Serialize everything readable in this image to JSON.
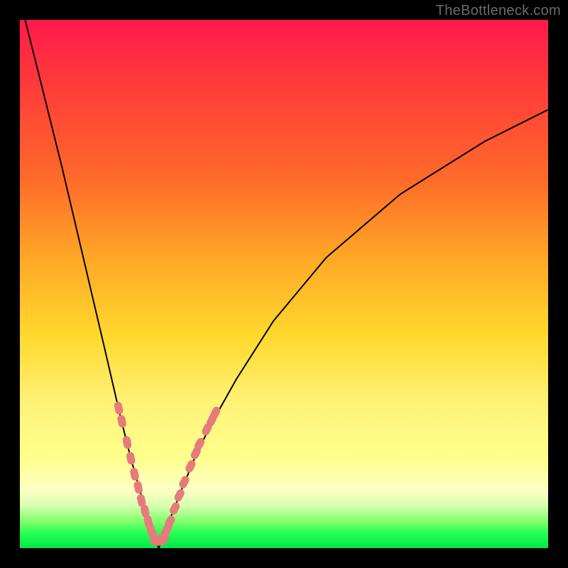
{
  "watermark": "TheBottleneck.com",
  "colors": {
    "background_frame": "#000000",
    "gradient_top": "#ff1a4d",
    "gradient_bottom": "#00e846",
    "curve": "#000000",
    "bead": "#e77a7a"
  },
  "chart_data": {
    "type": "line",
    "title": "",
    "xlabel": "",
    "ylabel": "",
    "xlim": [
      0,
      100
    ],
    "ylim": [
      0,
      100
    ],
    "grid": false,
    "legend": false,
    "notes": "Bottleneck-style V curve. Left branch descends steeply from top-left to a narrow minimum near x≈26, y≈0; right branch rises with diminishing slope toward top-right (~x=100, y≈83). Salmon 'bead' segments cluster on both branches roughly where y is between 5 and 30. Background is a vertical red→yellow→green gradient on a black frame.",
    "series": [
      {
        "name": "left_branch",
        "x": [
          1,
          4,
          8,
          12,
          16,
          19,
          21,
          23,
          24.5,
          25.5,
          26.3
        ],
        "y": [
          100,
          88,
          72,
          55,
          38,
          25,
          17,
          10,
          5,
          2,
          0
        ]
      },
      {
        "name": "right_branch",
        "x": [
          26.3,
          27.5,
          29,
          31,
          33.5,
          36.5,
          41,
          48,
          58,
          72,
          88,
          100
        ],
        "y": [
          0,
          3,
          7,
          12,
          18,
          24,
          32,
          43,
          55,
          67,
          77,
          83
        ]
      }
    ],
    "markers": {
      "name": "cluster_beads",
      "approx_y_range": [
        4,
        30
      ],
      "left_branch_points": [
        {
          "x": 18.7,
          "y": 26.5
        },
        {
          "x": 19.3,
          "y": 24.0
        },
        {
          "x": 20.3,
          "y": 20.0
        },
        {
          "x": 21.0,
          "y": 17.0
        },
        {
          "x": 21.7,
          "y": 14.0
        },
        {
          "x": 22.4,
          "y": 11.5
        },
        {
          "x": 23.0,
          "y": 9.0
        },
        {
          "x": 23.7,
          "y": 7.0
        },
        {
          "x": 24.3,
          "y": 5.0
        },
        {
          "x": 24.8,
          "y": 3.5
        },
        {
          "x": 25.3,
          "y": 2.3
        }
      ],
      "valley_points": [
        {
          "x": 25.8,
          "y": 1.4
        },
        {
          "x": 26.2,
          "y": 1.2
        },
        {
          "x": 26.6,
          "y": 1.4
        },
        {
          "x": 27.0,
          "y": 1.8
        }
      ],
      "right_branch_points": [
        {
          "x": 27.4,
          "y": 2.6
        },
        {
          "x": 27.9,
          "y": 3.7
        },
        {
          "x": 28.4,
          "y": 5.0
        },
        {
          "x": 29.3,
          "y": 7.5
        },
        {
          "x": 30.2,
          "y": 10.0
        },
        {
          "x": 31.1,
          "y": 12.5
        },
        {
          "x": 32.3,
          "y": 15.5
        },
        {
          "x": 33.3,
          "y": 18.0
        },
        {
          "x": 34.0,
          "y": 19.7
        },
        {
          "x": 35.4,
          "y": 22.5
        },
        {
          "x": 36.3,
          "y": 24.2
        },
        {
          "x": 37.0,
          "y": 25.6
        }
      ]
    }
  }
}
